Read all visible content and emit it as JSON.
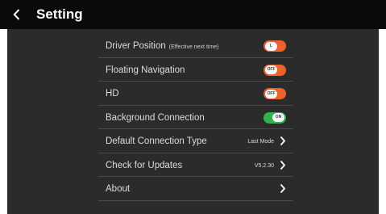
{
  "header": {
    "title": "Setting",
    "back_icon": "chevron-left-icon"
  },
  "colors": {
    "toggle_off": "#f0602b",
    "toggle_on": "#2fb34a",
    "background": "#2b2b2b",
    "topbar": "#0a0a0a"
  },
  "settings": [
    {
      "label": "Driver Position",
      "sublabel": "(Effective next time)",
      "control": "toggle",
      "state": "off",
      "toggle_text": "L"
    },
    {
      "label": "Floating Navigation",
      "control": "toggle",
      "state": "off",
      "toggle_text": "OFF"
    },
    {
      "label": "HD",
      "control": "toggle",
      "state": "off",
      "toggle_text": "OFF"
    },
    {
      "label": "Background Connection",
      "control": "toggle",
      "state": "on",
      "toggle_text": "ON"
    },
    {
      "label": "Default Connection Type",
      "control": "link",
      "value": "Last Mode",
      "icon": "chevron-right-icon"
    },
    {
      "label": "Check for Updates",
      "control": "link",
      "value": "V5.2.30",
      "icon": "chevron-right-icon"
    },
    {
      "label": "About",
      "control": "link",
      "icon": "chevron-right-icon"
    }
  ]
}
